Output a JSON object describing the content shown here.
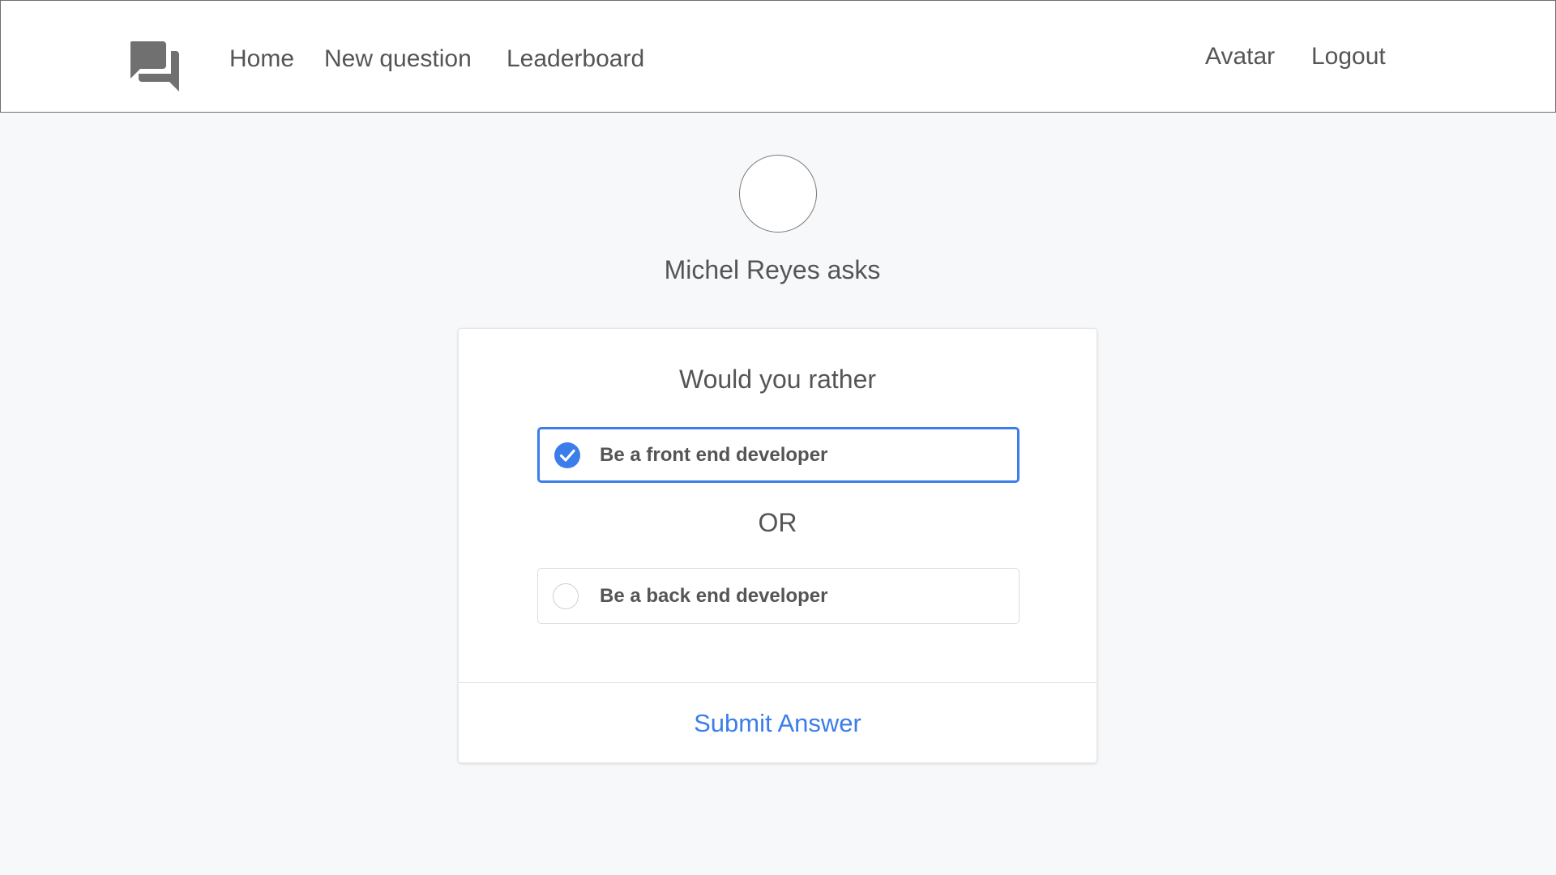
{
  "nav": {
    "logo_icon": "question-answer-icon",
    "left_links": [
      "Home",
      "New question",
      "Leaderboard"
    ],
    "avatar_label": "Avatar",
    "logout_label": "Logout"
  },
  "question": {
    "author_line": "Michel Reyes asks",
    "title": "Would you rather",
    "option_one": {
      "text": "Be a front end developer",
      "selected": true
    },
    "separator": "OR",
    "option_two": {
      "text": "Be a back end developer",
      "selected": false
    },
    "submit_label": "Submit Answer"
  },
  "colors": {
    "accent": "#3b7de9",
    "text": "#555555",
    "background": "#f7f8f9",
    "icon": "#707070"
  }
}
